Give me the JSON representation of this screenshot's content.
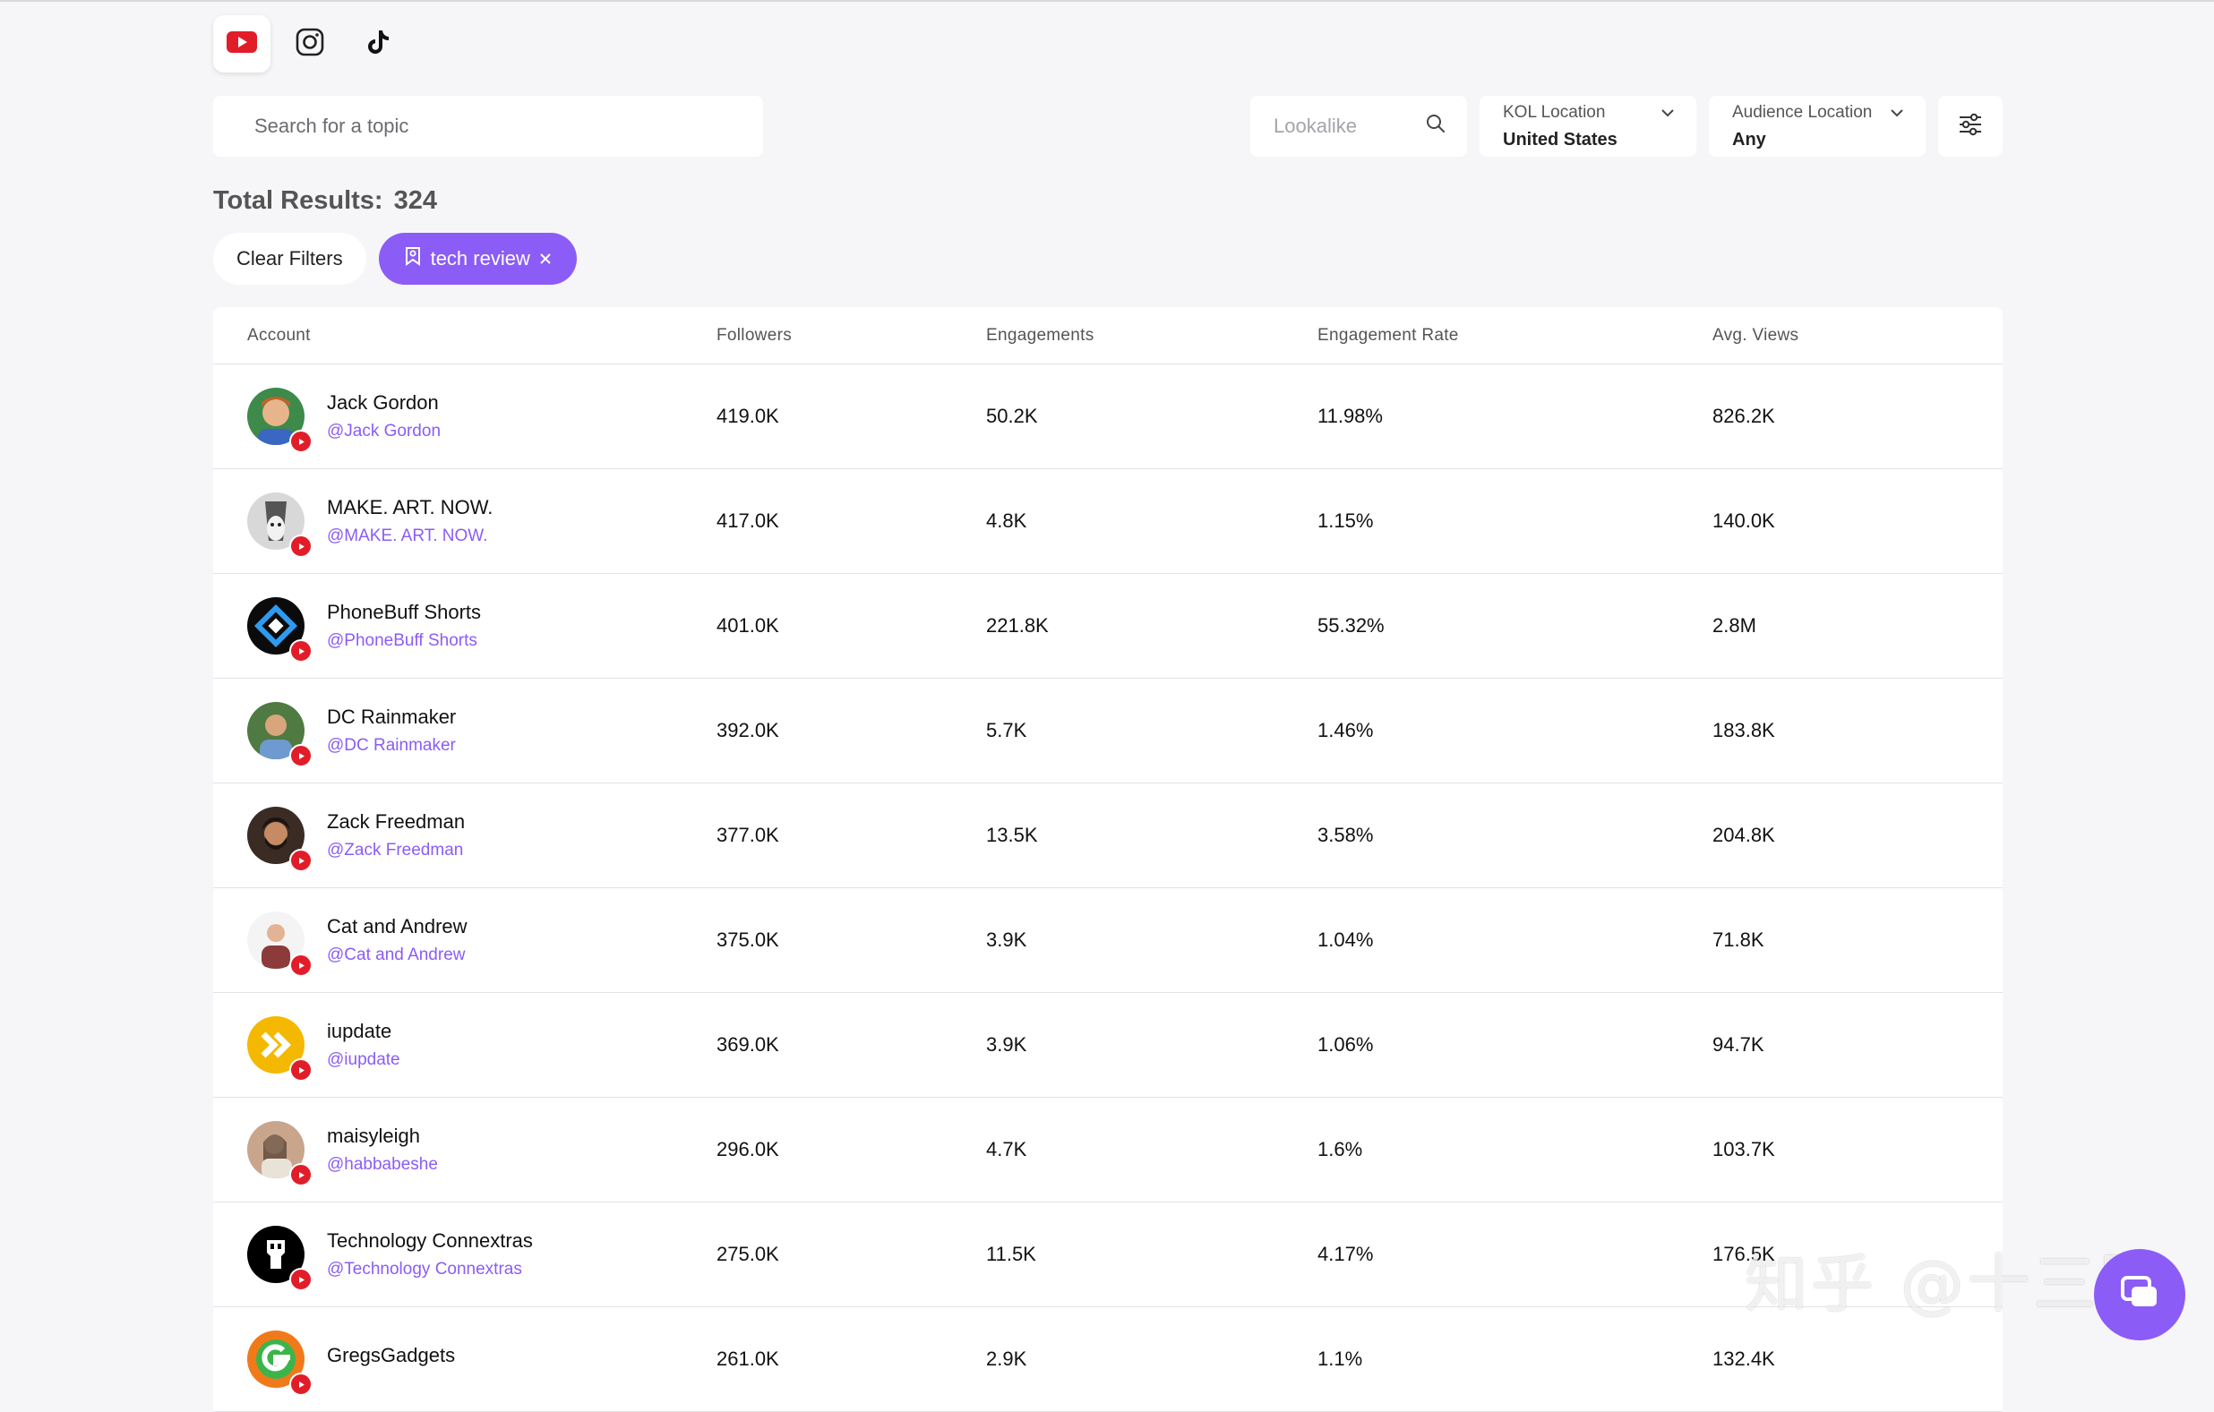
{
  "platforms": [
    {
      "name": "youtube",
      "icon": "youtube-icon",
      "active": true
    },
    {
      "name": "instagram",
      "icon": "instagram-icon",
      "active": false
    },
    {
      "name": "tiktok",
      "icon": "tiktok-icon",
      "active": false
    }
  ],
  "search": {
    "placeholder": "Search for a topic",
    "value": ""
  },
  "lookalike": {
    "placeholder": "Lookalike"
  },
  "kol_location": {
    "label": "KOL Location",
    "value": "United States"
  },
  "audience_location": {
    "label": "Audience Location",
    "value": "Any"
  },
  "results": {
    "label": "Total Results:",
    "count": "324"
  },
  "filters": {
    "clear_label": "Clear Filters",
    "active_tag": "tech review"
  },
  "table": {
    "headers": [
      "Account",
      "Followers",
      "Engagements",
      "Engagement Rate",
      "Avg. Views"
    ],
    "rows": [
      {
        "name": "Jack Gordon",
        "handle": "@Jack Gordon",
        "followers": "419.0K",
        "engagements": "50.2K",
        "rate": "11.98%",
        "views": "826.2K"
      },
      {
        "name": "MAKE. ART. NOW.",
        "handle": "@MAKE. ART. NOW.",
        "followers": "417.0K",
        "engagements": "4.8K",
        "rate": "1.15%",
        "views": "140.0K"
      },
      {
        "name": "PhoneBuff Shorts",
        "handle": "@PhoneBuff Shorts",
        "followers": "401.0K",
        "engagements": "221.8K",
        "rate": "55.32%",
        "views": "2.8M"
      },
      {
        "name": "DC Rainmaker",
        "handle": "@DC Rainmaker",
        "followers": "392.0K",
        "engagements": "5.7K",
        "rate": "1.46%",
        "views": "183.8K"
      },
      {
        "name": "Zack Freedman",
        "handle": "@Zack Freedman",
        "followers": "377.0K",
        "engagements": "13.5K",
        "rate": "3.58%",
        "views": "204.8K"
      },
      {
        "name": "Cat and Andrew",
        "handle": "@Cat and Andrew",
        "followers": "375.0K",
        "engagements": "3.9K",
        "rate": "1.04%",
        "views": "71.8K"
      },
      {
        "name": "iupdate",
        "handle": "@iupdate",
        "followers": "369.0K",
        "engagements": "3.9K",
        "rate": "1.06%",
        "views": "94.7K"
      },
      {
        "name": "maisyleigh",
        "handle": "@habbabeshe",
        "followers": "296.0K",
        "engagements": "4.7K",
        "rate": "1.6%",
        "views": "103.7K"
      },
      {
        "name": "Technology Connextras",
        "handle": "@Technology Connextras",
        "followers": "275.0K",
        "engagements": "11.5K",
        "rate": "4.17%",
        "views": "176.5K"
      },
      {
        "name": "GregsGadgets",
        "handle": "",
        "followers": "261.0K",
        "engagements": "2.9K",
        "rate": "1.1%",
        "views": "132.4K"
      }
    ]
  },
  "watermark": "知乎 @十三圈",
  "colors": {
    "accent": "#8b5cf6",
    "youtube": "#e11d2a",
    "background": "#f6f6f8"
  }
}
